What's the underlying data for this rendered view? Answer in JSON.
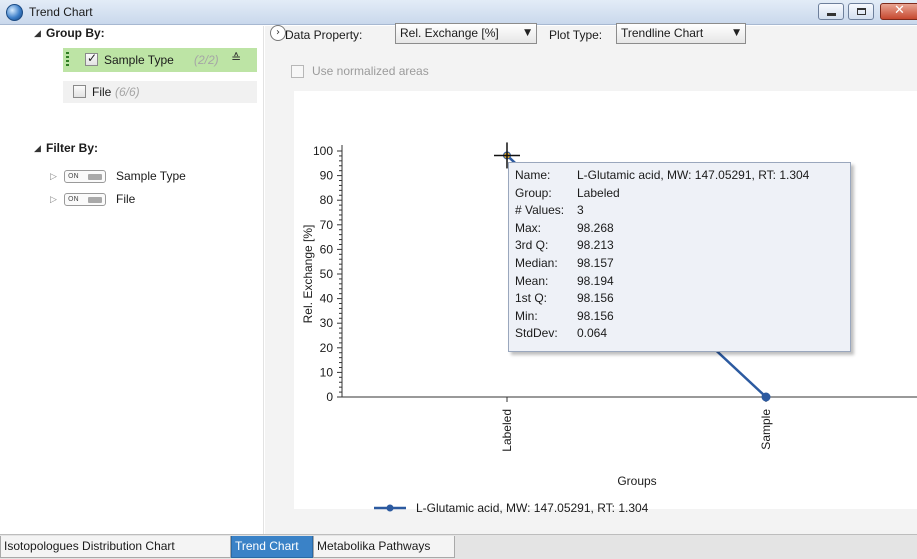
{
  "window": {
    "title": "Trend Chart"
  },
  "left_panel": {
    "group_by_label": "Group By:",
    "group_items": [
      {
        "label": "Sample Type",
        "count": "(2/2)",
        "checked": true
      },
      {
        "label": "File",
        "count": "(6/6)",
        "checked": false
      }
    ],
    "filter_by_label": "Filter By:",
    "filter_items": [
      {
        "label": "Sample Type",
        "toggle": "ON"
      },
      {
        "label": "File",
        "toggle": "ON"
      }
    ]
  },
  "toolbar": {
    "data_property_label": "Data Property:",
    "data_property_value": "Rel. Exchange [%]",
    "plot_type_label": "Plot Type:",
    "plot_type_value": "Trendline Chart",
    "normalized_label": "Use normalized areas"
  },
  "chart_data": {
    "type": "line",
    "categories": [
      "Labeled",
      "Sample"
    ],
    "series": [
      {
        "name": "L-Glutamic acid, MW: 147.05291, RT: 1.304",
        "values": [
          98.194,
          0
        ],
        "color": "#2c5aa0"
      }
    ],
    "xlabel": "Groups",
    "ylabel": "Rel. Exchange [%]",
    "ylim": [
      0,
      100
    ],
    "yticks": [
      "0",
      "10",
      "20",
      "30",
      "40",
      "50",
      "60",
      "70",
      "80",
      "90",
      "100"
    ],
    "legend": "bottom"
  },
  "tooltip": {
    "rows": [
      {
        "key": "Name:",
        "value": "L-Glutamic acid, MW: 147.05291, RT: 1.304"
      },
      {
        "key": "Group:",
        "value": "Labeled"
      },
      {
        "key": "# Values:",
        "value": "3"
      },
      {
        "key": "Max:",
        "value": "98.268"
      },
      {
        "key": "3rd Q:",
        "value": "98.213"
      },
      {
        "key": "Median:",
        "value": "98.157"
      },
      {
        "key": "Mean:",
        "value": "98.194"
      },
      {
        "key": "1st Q:",
        "value": "98.156"
      },
      {
        "key": "Min:",
        "value": "98.156"
      },
      {
        "key": "StdDev:",
        "value": "0.064"
      }
    ]
  },
  "tabs": [
    {
      "label": "Isotopologues Distribution Chart",
      "active": false
    },
    {
      "label": "Trend Chart",
      "active": true
    },
    {
      "label": "Metabolika Pathways",
      "active": false
    }
  ]
}
